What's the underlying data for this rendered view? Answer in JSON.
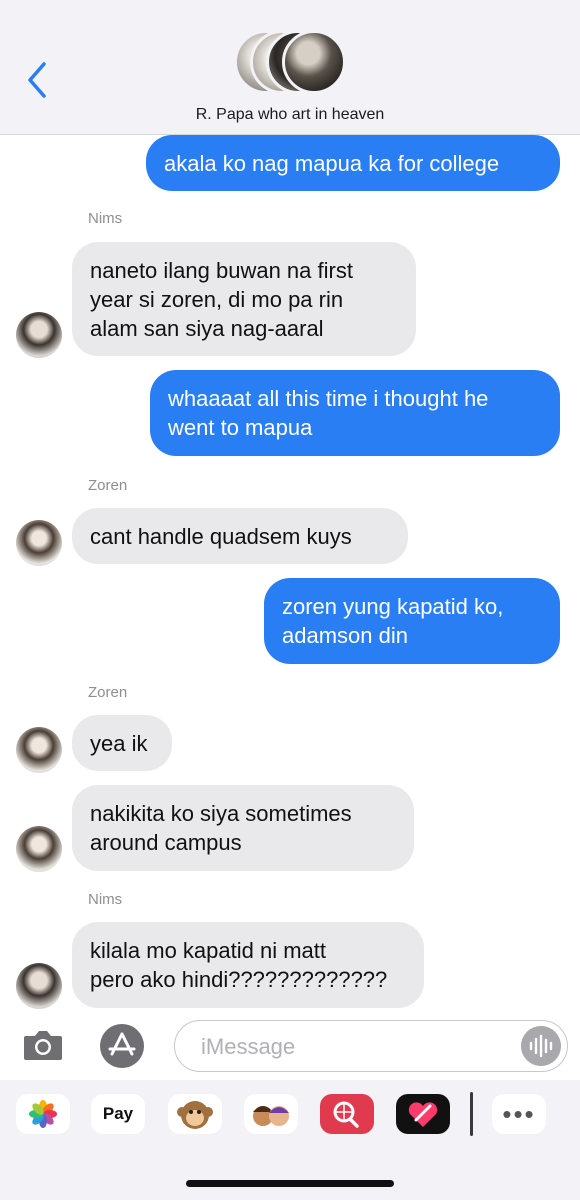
{
  "header": {
    "back_icon": "chevron-left-icon",
    "group_name": "R. Papa who art in heaven"
  },
  "messages": [
    {
      "direction": "outgoing",
      "text": "akala ko nag mapua ka for college"
    },
    {
      "direction": "incoming",
      "sender": "Nims",
      "text": "naneto ilang buwan na first\nyear si zoren, di mo pa rin\nalam san siya nag-aaral"
    },
    {
      "direction": "outgoing",
      "text": "whaaaat all this time i thought he\nwent to mapua"
    },
    {
      "direction": "incoming",
      "sender": "Zoren",
      "text": "cant handle quadsem kuys"
    },
    {
      "direction": "outgoing",
      "text": "zoren yung kapatid ko,\nadamson din"
    },
    {
      "direction": "incoming",
      "sender": "Zoren",
      "text": "yea ik"
    },
    {
      "direction": "incoming",
      "text": "nakikita ko siya sometimes\naround campus"
    },
    {
      "direction": "incoming",
      "sender": "Nims",
      "text": "kilala mo kapatid ni matt\npero ako hindi?????????????"
    }
  ],
  "composer": {
    "placeholder": "iMessage",
    "camera_icon": "camera-icon",
    "apps_icon": "app-store-icon",
    "audio_icon": "waveform-icon"
  },
  "app_drawer": {
    "items": [
      {
        "name": "photos-icon"
      },
      {
        "name": "apple-pay-icon",
        "label": "Pay"
      },
      {
        "name": "memoji-stickers-icon"
      },
      {
        "name": "memoji-icon"
      },
      {
        "name": "search-images-icon"
      },
      {
        "name": "digital-touch-icon"
      },
      {
        "name": "more-icon",
        "label": "•••"
      }
    ]
  },
  "colors": {
    "outgoing_bubble": "#2a7ef4",
    "incoming_bubble": "#e9e9eb",
    "header_bg": "#f2f2f7",
    "accent": "#2a7ef4"
  }
}
